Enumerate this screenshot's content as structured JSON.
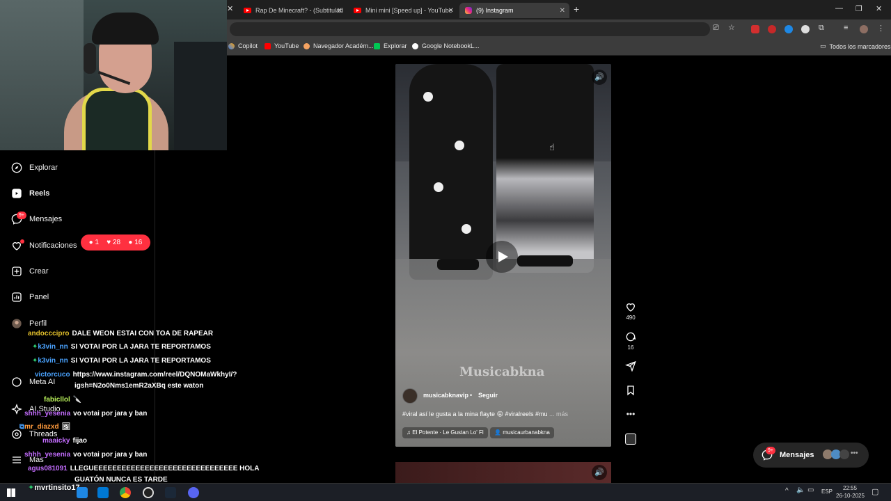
{
  "tabs": [
    {
      "label": "Rap De Minecraft? - (Subtitulad",
      "active": false
    },
    {
      "label": "Mini mini [Speed up] - YouTube",
      "active": false
    },
    {
      "label": "(9) Instagram",
      "active": true
    }
  ],
  "new_tab_label": "+",
  "bookmarks": [
    "Copilot",
    "YouTube",
    "Navegador Académ...",
    "Explorar",
    "Google NotebookL..."
  ],
  "all_bookmarks_label": "Todos los marcadores",
  "sidebar": {
    "items": [
      {
        "label": "Explorar",
        "icon": "compass-icon"
      },
      {
        "label": "Reels",
        "icon": "reels-icon",
        "bold": true
      },
      {
        "label": "Mensajes",
        "icon": "messenger-icon",
        "badge": "9+"
      },
      {
        "label": "Notificaciones",
        "icon": "heart-icon"
      },
      {
        "label": "Crear",
        "icon": "plus-square-icon"
      },
      {
        "label": "Panel",
        "icon": "chart-icon"
      },
      {
        "label": "Perfil",
        "icon": "avatar"
      },
      {
        "label": "Meta AI",
        "icon": "meta-ai-icon"
      },
      {
        "label": "AI Studio",
        "icon": "ai-studio-icon"
      },
      {
        "label": "Threads",
        "icon": "threads-icon"
      },
      {
        "label": "Más",
        "icon": "menu-icon"
      }
    ]
  },
  "notifications_pill": {
    "comments": "1",
    "likes": "28",
    "follows": "16"
  },
  "chat": [
    {
      "user": "andocccipro",
      "message": "DALE WEON ESTAI CON TOA DE RAPEAR",
      "color": "#e6c32c"
    },
    {
      "user": "k3vin_nn",
      "message": "SI VOTAI POR LA JARA TE REPORTAMOS",
      "color": "#4aa3ff"
    },
    {
      "user": "k3vin_nn",
      "message": "SI VOTAI POR LA JARA TE REPORTAMOS",
      "color": "#4aa3ff"
    },
    {
      "user": "victorcuco",
      "message": "https://www.instagram.com/reel/DQNOMaWkhyI/?",
      "color": "#4aa3ff"
    },
    {
      "user": "",
      "message": "igsh=N2o0Nms1emR2aXBq este waton",
      "color": "#4aa3ff"
    },
    {
      "user": "fabicllol",
      "message": "🔪",
      "color": "#b8f05a"
    },
    {
      "user": "shhh_yesenia",
      "message": "vo votai por jara y ban",
      "color": "#c46dff"
    },
    {
      "user": "mr_diazxd",
      "message": "🖼",
      "color": "#ff9a3c"
    },
    {
      "user": "maaicky",
      "message": "fijao",
      "color": "#c46dff"
    },
    {
      "user": "shhh_yesenia",
      "message": "vo votai por jara y ban",
      "color": "#c46dff"
    },
    {
      "user": "agus081091",
      "message": "LLEGUEEEEEEEEEEEEEEEEEEEEEEEEEEEEEEE HOLA",
      "color": "#c46dff"
    },
    {
      "user": "",
      "message": "GUATÓN NUNCA ES TARDE",
      "color": "#c46dff"
    },
    {
      "user": "mvrtinsito17",
      "message": "",
      "color": "#b8f05a"
    }
  ],
  "reel": {
    "username": "musicabknavip",
    "follow_label": "Seguir",
    "caption": "#viral así le gusta a la mina flayte 😝 #viralreels #mu",
    "more_label": "... más",
    "audio": "El Potente · Le Gustan Lo' Fl",
    "tagged_user": "musicaurbanabkna",
    "watermark": "Musicabkna",
    "likes": "490",
    "comments": "16"
  },
  "messages_button": {
    "label": "Mensajes",
    "badge": "9+"
  },
  "taskbar": {
    "language": "ESP",
    "time": "22:55",
    "date": "26-10-2025"
  },
  "colors": {
    "notification_red": "#ff3040",
    "bg": "#000000",
    "chrome_dark": "#1f1f1f",
    "chrome_mid": "#3c3c3c"
  }
}
